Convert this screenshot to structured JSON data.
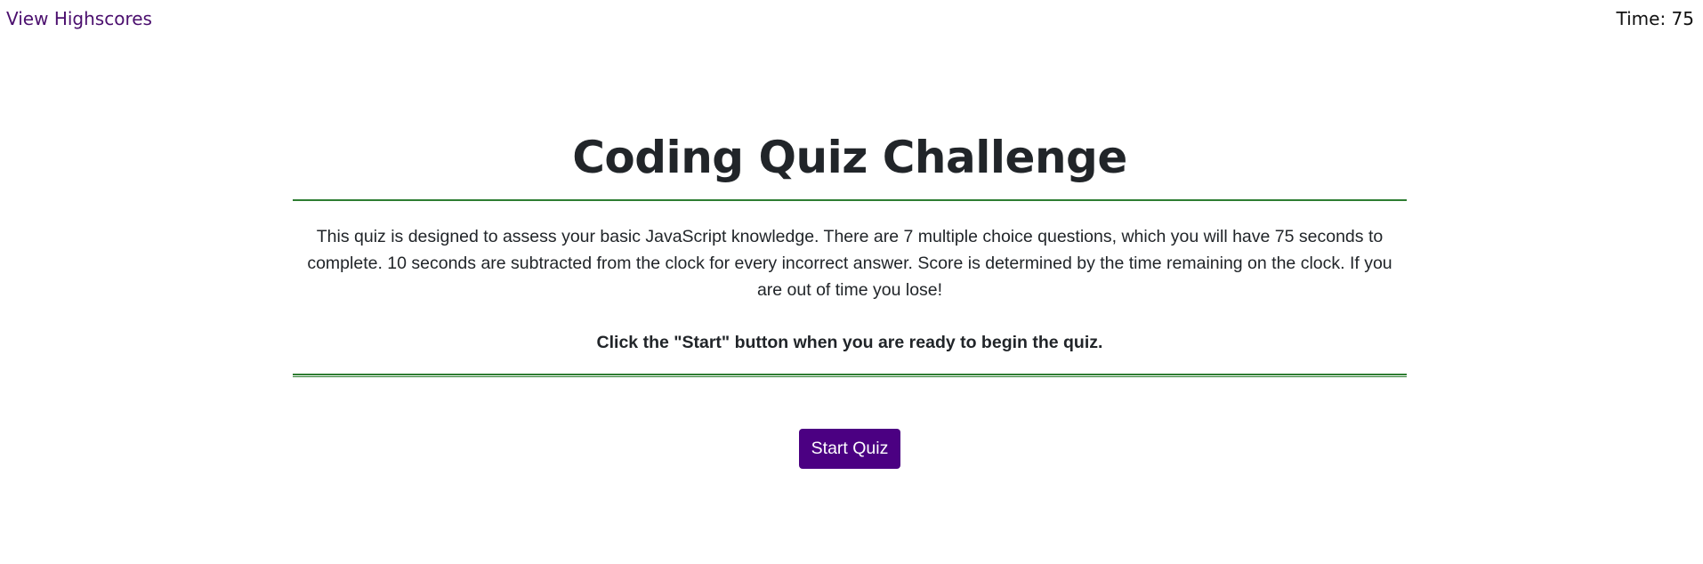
{
  "header": {
    "highscores_link": "View Highscores",
    "timer_label": "Time:",
    "timer_value": "75"
  },
  "main": {
    "title": "Coding Quiz Challenge",
    "description": "This quiz is designed to assess your basic JavaScript knowledge. There are 7 multiple choice questions, which you will have 75 seconds to complete. 10 seconds are subtracted from the clock for every incorrect answer. Score is determined by the time remaining on the clock. If you are out of time you lose!",
    "instruction": "Click the \"Start\" button when you are ready to begin the quiz.",
    "start_button": "Start Quiz"
  },
  "colors": {
    "link": "#4b0f6e",
    "rule": "#2e7d32",
    "button_bg": "#4b0082",
    "button_text": "#ffffff"
  }
}
